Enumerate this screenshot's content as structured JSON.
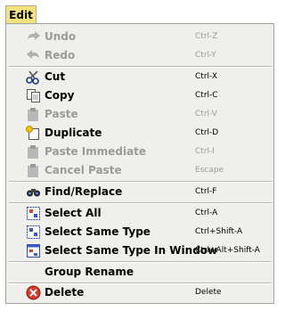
{
  "menu": {
    "title": "Edit"
  },
  "items": {
    "undo": {
      "label": "Undo",
      "shortcut": "Ctrl-Z"
    },
    "redo": {
      "label": "Redo",
      "shortcut": "Ctrl-Y"
    },
    "cut": {
      "label": "Cut",
      "shortcut": "Ctrl-X"
    },
    "copy": {
      "label": "Copy",
      "shortcut": "Ctrl-C"
    },
    "paste": {
      "label": "Paste",
      "shortcut": "Ctrl-V"
    },
    "duplicate": {
      "label": "Duplicate",
      "shortcut": "Ctrl-D"
    },
    "paste_immediate": {
      "label": "Paste Immediate",
      "shortcut": "Ctrl-I"
    },
    "cancel_paste": {
      "label": "Cancel Paste",
      "shortcut": "Escape"
    },
    "find_replace": {
      "label": "Find/Replace",
      "shortcut": "Ctrl-F"
    },
    "select_all": {
      "label": "Select All",
      "shortcut": "Ctrl-A"
    },
    "select_same_type": {
      "label": "Select Same Type",
      "shortcut": "Ctrl+Shift-A"
    },
    "select_same_type_window": {
      "label": "Select Same Type In Window",
      "shortcut": "Ctrl+Alt+Shift-A"
    },
    "group_rename": {
      "label": "Group Rename",
      "shortcut": ""
    },
    "delete": {
      "label": "Delete",
      "shortcut": "Delete"
    }
  },
  "states": {
    "disabled": [
      "undo",
      "redo",
      "paste",
      "paste_immediate",
      "cancel_paste"
    ]
  },
  "colors": {
    "menu_title_bg": "#f4e27a",
    "menu_bg": "#efefeb",
    "disabled_text": "#9a9a9a",
    "delete_icon": "#d83a2a"
  }
}
